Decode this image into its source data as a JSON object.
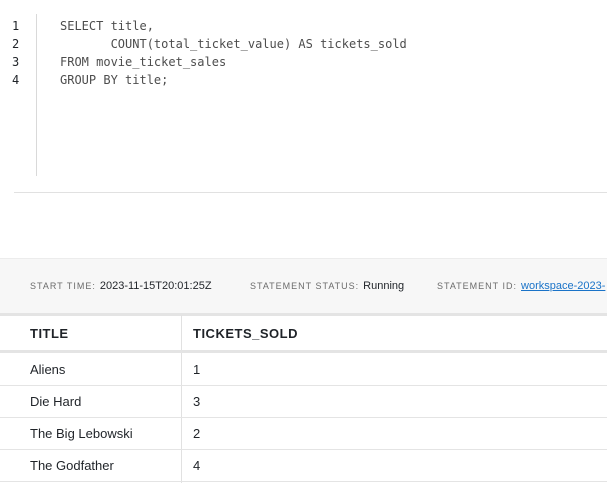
{
  "editor": {
    "line_numbers": [
      "1",
      "2",
      "3",
      "4"
    ],
    "code_lines": [
      "SELECT title,",
      "       COUNT(total_ticket_value) AS tickets_sold",
      "FROM movie_ticket_sales",
      "GROUP BY title;"
    ]
  },
  "status": {
    "start_time_label": "START TIME:",
    "start_time_value": "2023-11-15T20:01:25Z",
    "statement_status_label": "STATEMENT STATUS:",
    "statement_status_value": "Running",
    "statement_id_label": "STATEMENT ID:",
    "statement_id_value": "workspace-2023-"
  },
  "results": {
    "columns": [
      "TITLE",
      "TICKETS_SOLD"
    ],
    "rows": [
      [
        "Aliens",
        "1"
      ],
      [
        "Die Hard",
        "3"
      ],
      [
        "The Big Lebowski",
        "2"
      ],
      [
        "The Godfather",
        "4"
      ]
    ]
  }
}
